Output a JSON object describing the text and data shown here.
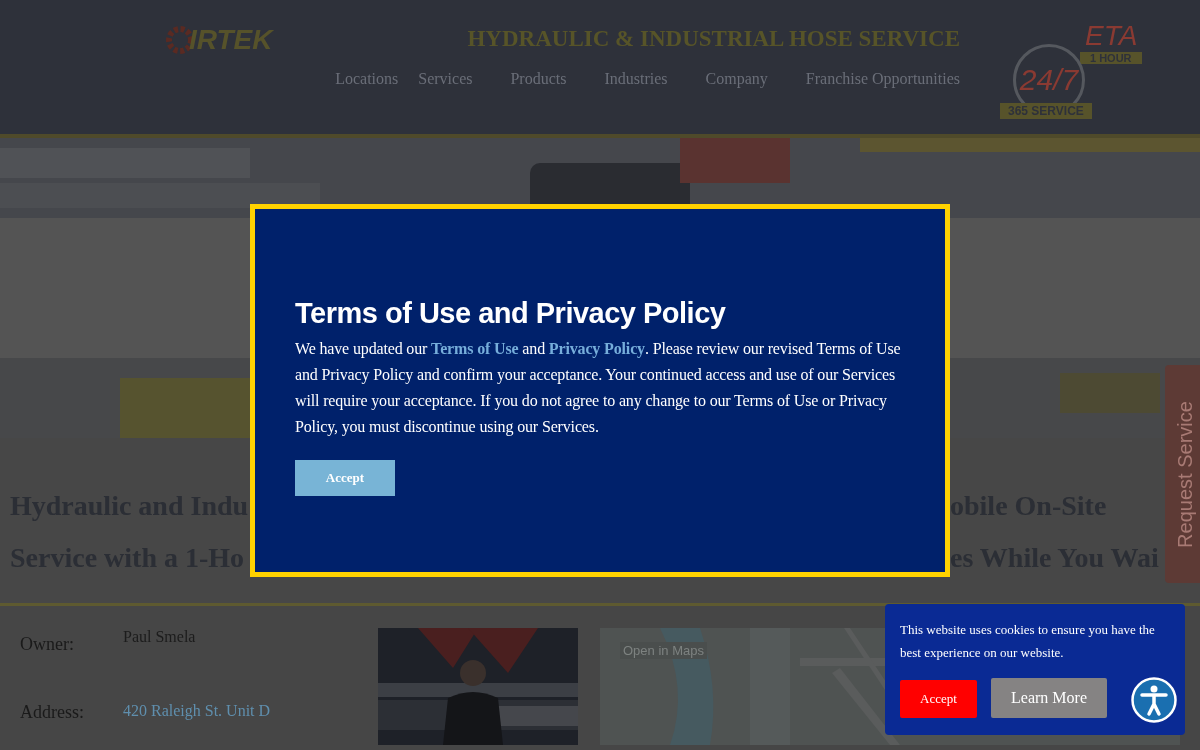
{
  "header": {
    "logo_text": "IRTEK",
    "tagline": "HYDRAULIC & INDUSTRIAL HOSE SERVICE",
    "nav": [
      {
        "label": "Locations"
      },
      {
        "label": "Services"
      },
      {
        "label": "Products"
      },
      {
        "label": "Industries"
      },
      {
        "label": "Company"
      },
      {
        "label": "Franchise Opportunities"
      }
    ],
    "badge": {
      "eta": "ETA",
      "hour": "1 HOUR",
      "hours": "24/7",
      "service": "365 SERVICE"
    }
  },
  "headline": [
    {
      "left": "Hydraulic and Indu",
      "right": "obile On-Site"
    },
    {
      "left": "Service with a 1-Ho",
      "right": "es While You Wai"
    }
  ],
  "details": [
    {
      "label": "Owner:",
      "value": "Paul Smela",
      "kind": "text"
    },
    {
      "label": "Address:",
      "value": "420 Raleigh St. Unit D",
      "kind": "link"
    }
  ],
  "map": {
    "open_button": "Open in Maps"
  },
  "request_tab": "Request Service",
  "modal": {
    "title": "Terms of Use and Privacy Policy",
    "body": [
      {
        "kind": "text",
        "text": "We have updated our "
      },
      {
        "kind": "link",
        "text": "Terms of Use"
      },
      {
        "kind": "text",
        "text": " and "
      },
      {
        "kind": "link",
        "text": "Privacy Policy"
      },
      {
        "kind": "text",
        "text": ". Please review our revised Terms of Use and Privacy Policy and confirm your acceptance. Your continued access and use of our Services will require your acceptance. If you do not agree to any change to our Terms of Use or Privacy Policy, you must discontinue using our Services."
      }
    ],
    "button": "Accept"
  },
  "cookie": {
    "text": "This website uses cookies to ensure you have the best experience on our website.",
    "accept": "Accept",
    "learn_more": "Learn More"
  }
}
